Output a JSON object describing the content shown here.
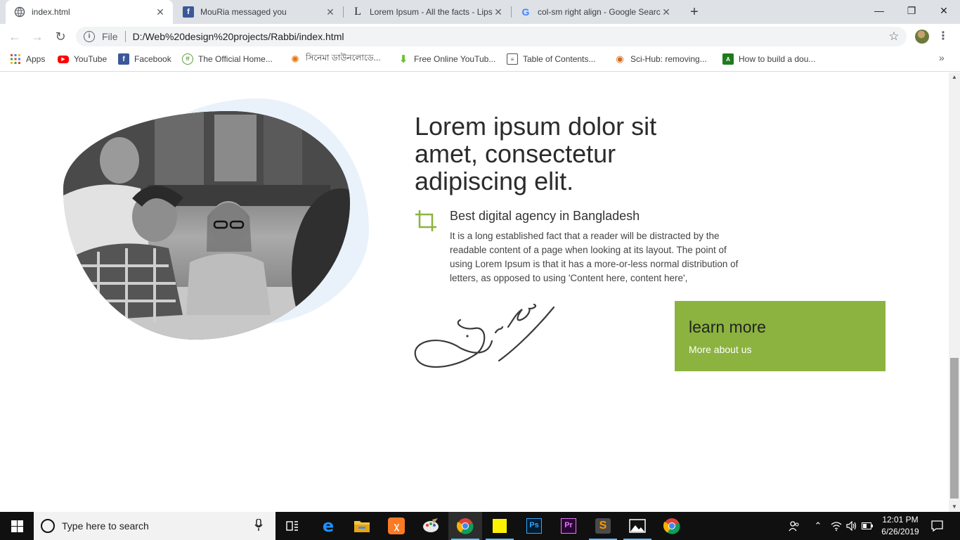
{
  "browser": {
    "tabs": [
      {
        "title": "index.html",
        "icon": "globe-icon",
        "active": true
      },
      {
        "title": "MouRia messaged you",
        "icon": "facebook-icon",
        "active": false
      },
      {
        "title": "Lorem Ipsum - All the facts - Lipsum",
        "icon": "lipsum-icon",
        "active": false
      },
      {
        "title": "col-sm right align - Google Search",
        "icon": "google-icon",
        "active": false
      }
    ],
    "address": {
      "scheme": "File",
      "url": "D:/Web%20design%20projects/Rabbi/index.html"
    },
    "bookmarks": [
      {
        "label": "Apps",
        "icon": "apps-grid-icon"
      },
      {
        "label": "YouTube",
        "icon": "youtube-icon"
      },
      {
        "label": "Facebook",
        "icon": "facebook-icon"
      },
      {
        "label": "The Official Home...",
        "icon": "official-home-icon"
      },
      {
        "label": "সিনেমা ডাউনলোডে...",
        "icon": "cinema-icon"
      },
      {
        "label": "Free Online YouTub...",
        "icon": "download-arrow-icon"
      },
      {
        "label": "Table of Contents...",
        "icon": "document-icon"
      },
      {
        "label": "Sci-Hub: removing...",
        "icon": "scihub-icon"
      },
      {
        "label": "How to build a dou...",
        "icon": "green-app-icon"
      }
    ]
  },
  "content": {
    "heading": "Lorem ipsum dolor sit amet, consectetur adipiscing elit.",
    "subtitle": "Best digital agency in Bangladesh",
    "paragraph": "It is a long established fact that a reader will be distracted by the readable content of a page when looking at its layout. The point of using Lorem Ipsum is that it has a more-or-less normal distribution of letters, as opposed to using 'Content here, content here',",
    "cta": {
      "title": "learn more",
      "link": "More about us"
    },
    "accent_color": "#8cb33f",
    "blob_color": "#e9f2fb"
  },
  "taskbar": {
    "search_placeholder": "Type here to search",
    "time": "12:01 PM",
    "date": "6/26/2019"
  }
}
